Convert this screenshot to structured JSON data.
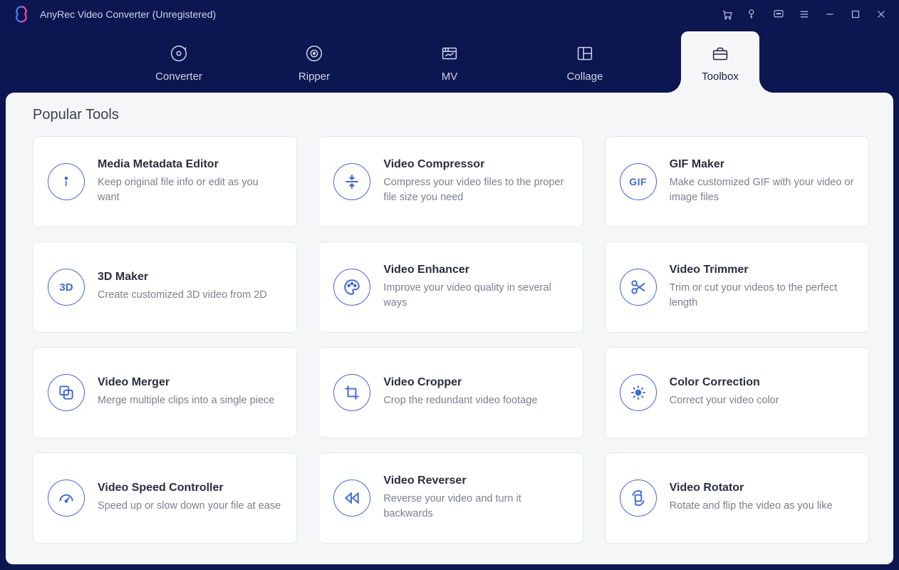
{
  "app": {
    "title": "AnyRec Video Converter (Unregistered)"
  },
  "tabs": {
    "converter": "Converter",
    "ripper": "Ripper",
    "mv": "MV",
    "collage": "Collage",
    "toolbox": "Toolbox",
    "active": "toolbox"
  },
  "section": {
    "title": "Popular Tools"
  },
  "tools": [
    {
      "key": "metadata",
      "title": "Media Metadata Editor",
      "desc": "Keep original file info or edit as you want"
    },
    {
      "key": "compressor",
      "title": "Video Compressor",
      "desc": "Compress your video files to the proper file size you need"
    },
    {
      "key": "gifmaker",
      "title": "GIF Maker",
      "desc": "Make customized GIF with your video or image files"
    },
    {
      "key": "3dmaker",
      "title": "3D Maker",
      "desc": "Create customized 3D video from 2D"
    },
    {
      "key": "enhancer",
      "title": "Video Enhancer",
      "desc": "Improve your video quality in several ways"
    },
    {
      "key": "trimmer",
      "title": "Video Trimmer",
      "desc": "Trim or cut your videos to the perfect length"
    },
    {
      "key": "merger",
      "title": "Video Merger",
      "desc": "Merge multiple clips into a single piece"
    },
    {
      "key": "cropper",
      "title": "Video Cropper",
      "desc": "Crop the redundant video footage"
    },
    {
      "key": "colorcorr",
      "title": "Color Correction",
      "desc": "Correct your video color"
    },
    {
      "key": "speed",
      "title": "Video Speed Controller",
      "desc": "Speed up or slow down your file at ease"
    },
    {
      "key": "reverser",
      "title": "Video Reverser",
      "desc": "Reverse your video and turn it backwards"
    },
    {
      "key": "rotator",
      "title": "Video Rotator",
      "desc": "Rotate and flip the video as you like"
    }
  ]
}
